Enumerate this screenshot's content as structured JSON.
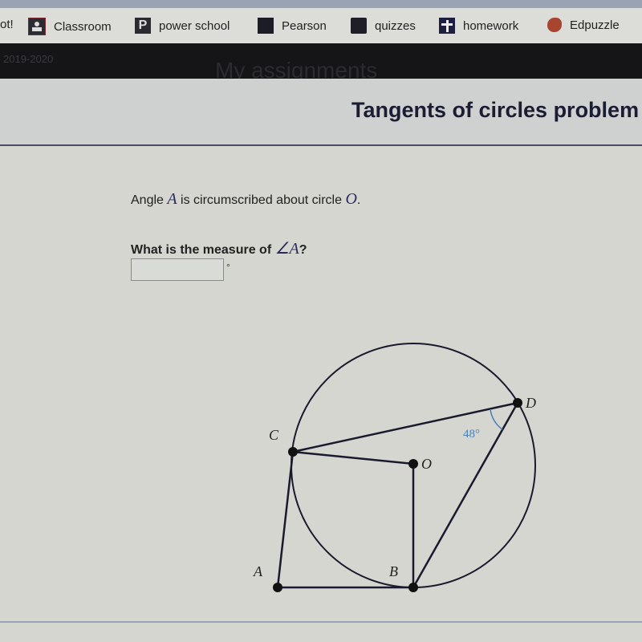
{
  "bookmarks": [
    {
      "label": "ot!",
      "icon": "none"
    },
    {
      "label": "Classroom",
      "icon": "classroom-icon"
    },
    {
      "label": "power school",
      "icon": "powerschool-icon"
    },
    {
      "label": "Pearson",
      "icon": "pearson-icon"
    },
    {
      "label": "quizzes",
      "icon": "folder-icon"
    },
    {
      "label": "homework",
      "icon": "cross-icon"
    },
    {
      "label": "Edpuzzle",
      "icon": "edpuzzle-icon"
    }
  ],
  "header": {
    "year": "2019-2020",
    "nav_title": "My assignments"
  },
  "exercise": {
    "title": "Tangents of circles problem",
    "statement_pre": "Angle ",
    "statement_var1": "A",
    "statement_mid": " is circumscribed about circle ",
    "statement_var2": "O",
    "statement_end": ".",
    "question_pre": "What is the measure of ",
    "question_var": "∠A",
    "question_end": "?",
    "answer_value": "",
    "answer_unit": "°"
  },
  "diagram": {
    "labels": {
      "A": "A",
      "B": "B",
      "C": "C",
      "D": "D",
      "O": "O"
    },
    "angle_label": "48°",
    "angle_color": "#4a7fb5"
  }
}
